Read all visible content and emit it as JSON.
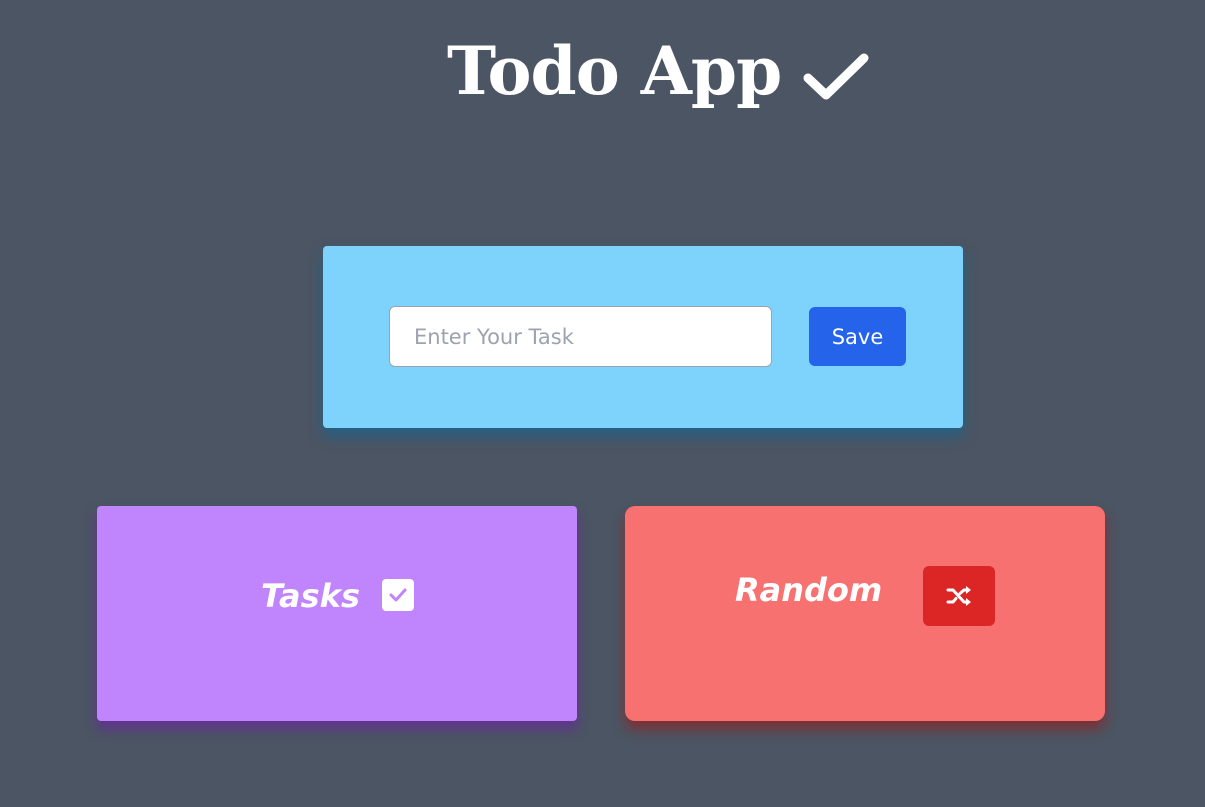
{
  "header": {
    "title": "Todo App",
    "title_icon": "checkmark-icon"
  },
  "task_form": {
    "input_value": "",
    "input_placeholder": "Enter Your Task",
    "save_label": "Save"
  },
  "tiles": {
    "tasks": {
      "label": "Tasks",
      "icon": "checkbox-checked-icon",
      "color": "#c084fc"
    },
    "random": {
      "label": "Random",
      "icon": "shuffle-icon",
      "color": "#f87171",
      "button_color": "#dc2626"
    }
  },
  "colors": {
    "background": "#4b5563",
    "form_card": "#7dd3fc",
    "save_button": "#2563eb"
  }
}
